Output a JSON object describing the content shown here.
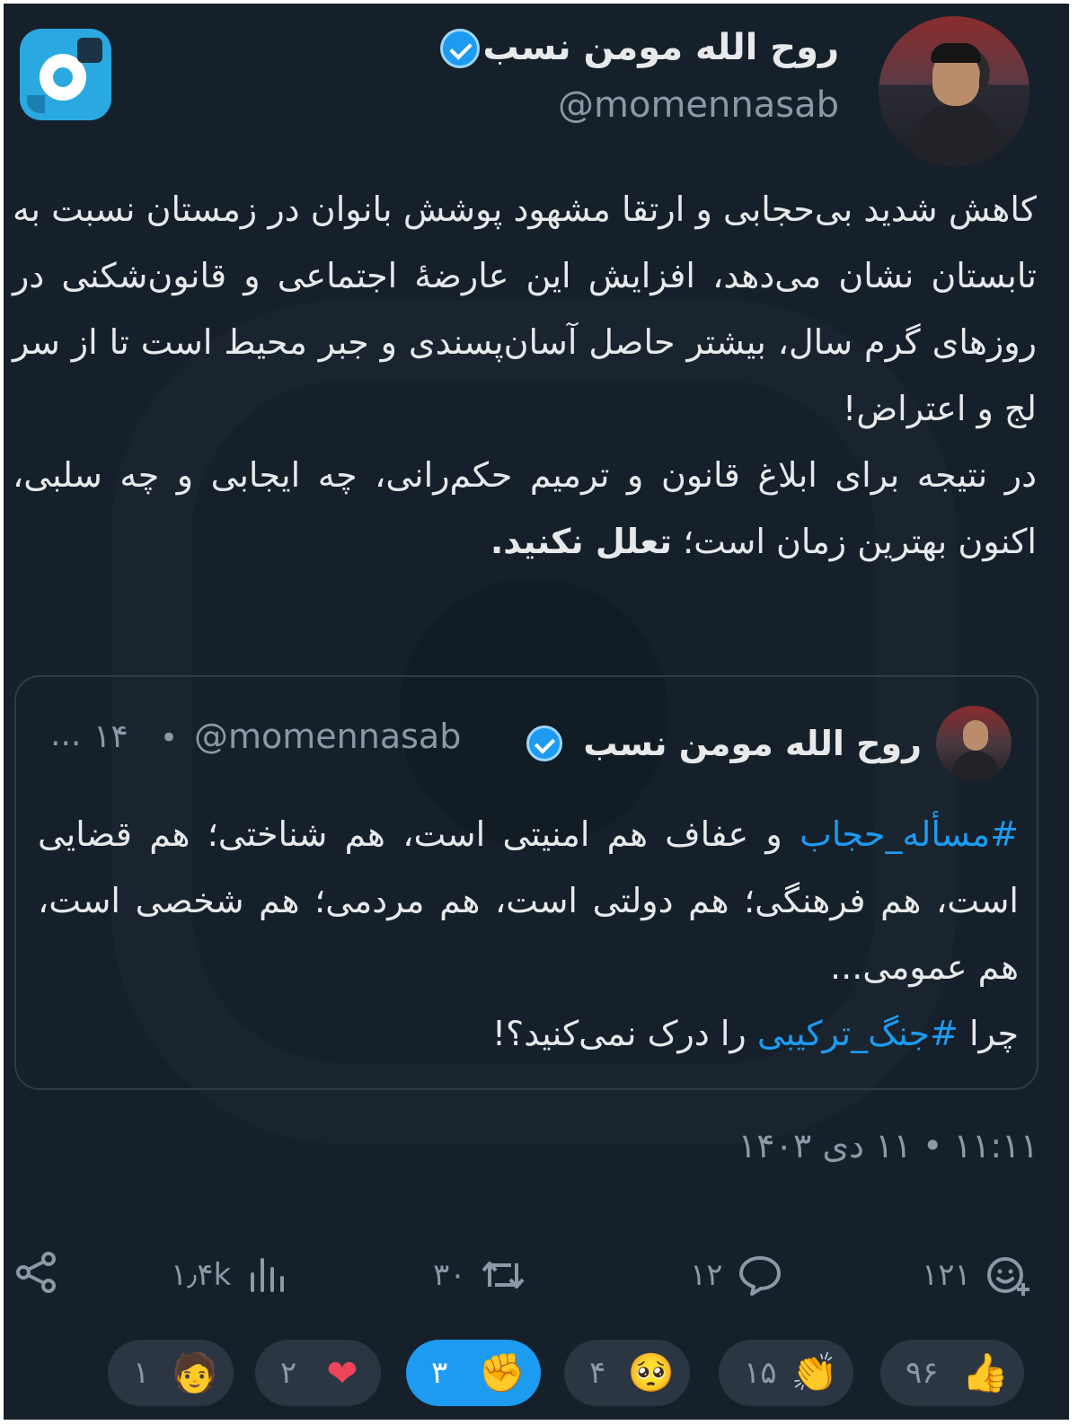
{
  "author": {
    "name": "روح الله مومن نسب",
    "handle": "@momennasab"
  },
  "tweet": {
    "paragraph1": "کاهش شدید بی‌حجابی و ارتقا مشهود پوشش بانوان در زمستان نسبت به تابستان نشان می‌دهد، افزایش این عارضهٔ اجتماعی و قانون‌شکنی در روزهای گرم سال، بیشتر حاصل آسان‌پسندی و جبر محیط است تا از سر لج و اعتراض!",
    "paragraph2_start": "در نتیجه برای ابلاغ قانون و ترمیم حکم‌رانی، چه ایجابی و چه سلبی، اکنون بهترین زمان است؛ ",
    "paragraph2_bold": "تعلل نکنید."
  },
  "quote": {
    "name": "روح الله مومن نسب",
    "handle": "@momennasab",
    "dot": "•",
    "time": "۱۴",
    "more": "...",
    "hashtag1": "#مسأله_حجاب",
    "line1_rest": " و عفاف هم امنیتی است، هم شناختی؛ هم قضایی است، هم فرهنگی؛ هم دولتی است، هم مردمی؛ هم شخصی است، هم عمومی...",
    "line2_start": "چرا ",
    "hashtag2": "#جنگ_ترکیبی",
    "line2_end": " را درک نمی‌کنید؟!"
  },
  "timestamp": "۱۱:۱۱ • ۱۱ دی ۱۴۰۳",
  "actions": {
    "views": "۱٫۴k",
    "retweets": "۳۰",
    "replies": "۱۲",
    "likes": "۱۲۱"
  },
  "reactions": [
    {
      "count": "۱",
      "icon": "person-icon",
      "glyph": "🧑"
    },
    {
      "count": "۲",
      "icon": "heart-icon",
      "glyph": "❤"
    },
    {
      "count": "۳",
      "icon": "fist-icon",
      "glyph": "✊"
    },
    {
      "count": "۴",
      "icon": "pleading-face-icon",
      "glyph": "🥺"
    },
    {
      "count": "۱۵",
      "icon": "clapping-hands-icon",
      "glyph": "👏"
    },
    {
      "count": "۹۶",
      "icon": "thumbs-up-icon",
      "glyph": "👍"
    }
  ],
  "colors": {
    "background": "#15202b",
    "text": "#e7e9ea",
    "muted": "#8b98a5",
    "accent": "#1d9bf0"
  }
}
